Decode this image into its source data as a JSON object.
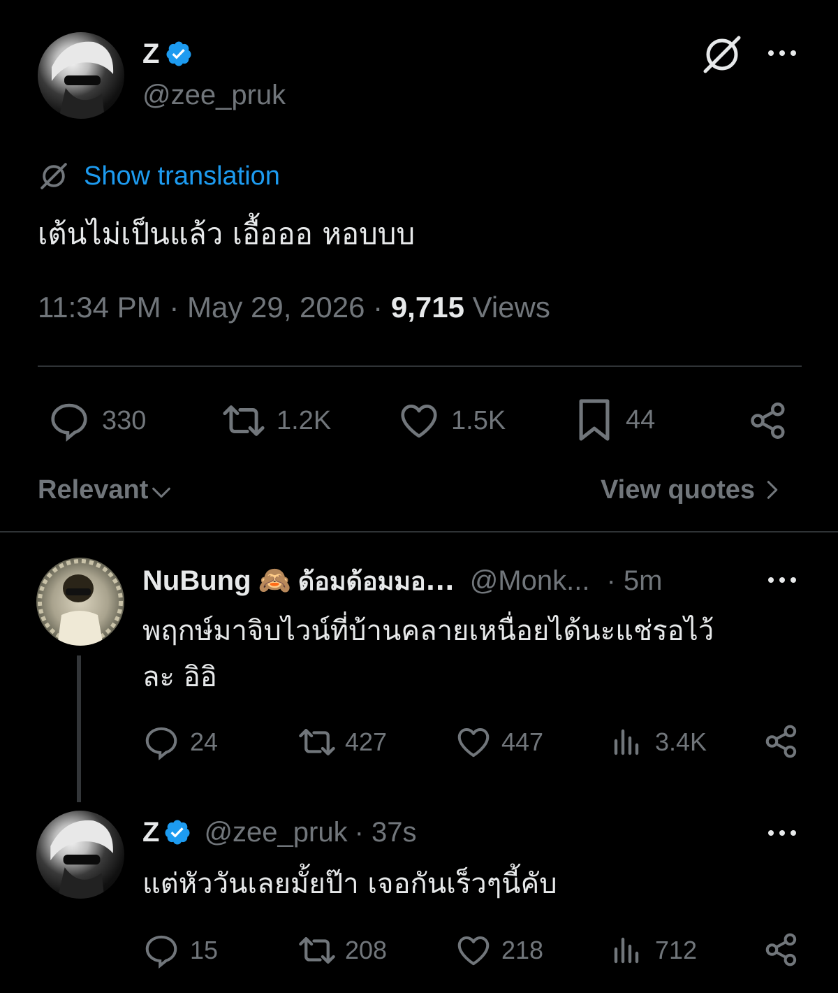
{
  "main_tweet": {
    "author_name": "Z",
    "handle": "@zee_pruk",
    "show_translation": "Show translation",
    "text": "เต้นไม่เป็นแล้ว เอื้อออ หอบบบ",
    "time": "11:34 PM",
    "date": "May 29, 2026",
    "views_count": "9,715",
    "views_label": "Views",
    "replies": "330",
    "retweets": "1.2K",
    "likes": "1.5K",
    "bookmarks": "44"
  },
  "filter": {
    "relevant_label": "Relevant",
    "view_quotes_label": "View quotes"
  },
  "replies": [
    {
      "author_name": "NuBung",
      "emoji": "🙈",
      "author_suffix": "ด้อมด้อมมอ...",
      "handle": "@Monk...",
      "age": "· 5m",
      "text_line1": "พฤกษ์มาจิบไวน์ที่บ้านคลายเหนื่อยได้นะแช่รอไว้",
      "text_line2": "ละ อิอิ",
      "replies": "24",
      "retweets": "427",
      "likes": "447",
      "views": "3.4K"
    },
    {
      "author_name": "Z",
      "handle": "@zee_pruk",
      "age": "· 37s",
      "text": "แต่หัววันเลยมั้ยป๊า เจอกันเร็วๆนี้คับ",
      "replies": "15",
      "retweets": "208",
      "likes": "218",
      "views": "712"
    }
  ],
  "colors": {
    "background": "#000000",
    "text": "#e7e9ea",
    "muted": "#71767b",
    "link": "#1d9bf0",
    "verified": "#1d9bf0",
    "divider": "#2f3336"
  }
}
